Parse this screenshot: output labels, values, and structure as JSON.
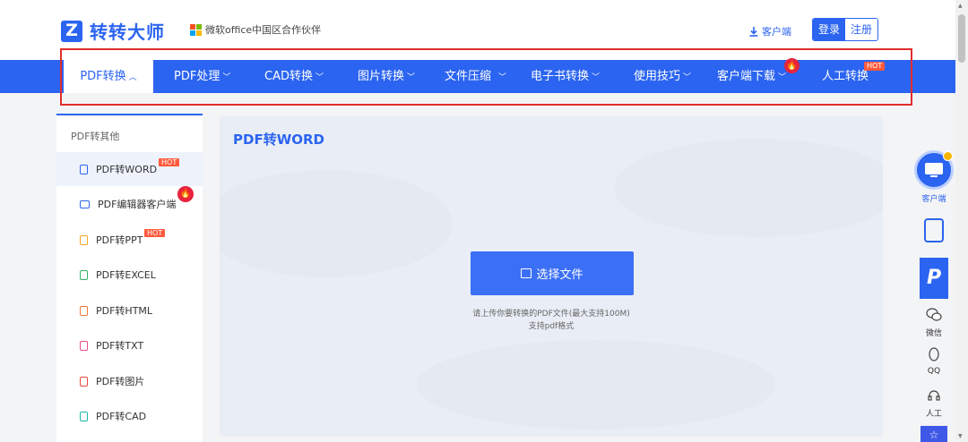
{
  "header": {
    "logo_text": "转转大师",
    "partner_text": "微软office中国区合作伙伴",
    "client_link": "客户端",
    "login": "登录",
    "register": "注册"
  },
  "nav": {
    "items": [
      {
        "label": "PDF转换",
        "chevron": "up",
        "active": true
      },
      {
        "label": "PDF处理",
        "chevron": "down"
      },
      {
        "label": "CAD转换",
        "chevron": "down"
      },
      {
        "label": "图片转换",
        "chevron": "down"
      },
      {
        "label": "文件压缩",
        "chevron": "down"
      },
      {
        "label": "电子书转换",
        "chevron": "down"
      },
      {
        "label": "使用技巧",
        "chevron": "down"
      },
      {
        "label": "客户端下载",
        "chevron": "down",
        "badge": "fire-icon"
      },
      {
        "label": "人工转换",
        "badge_text": "HOT"
      }
    ]
  },
  "sidebar": {
    "title": "PDF转其他",
    "items": [
      {
        "label": "PDF转WORD",
        "icon": "doc-icon",
        "color": "#2b64f0",
        "tag": "HOT",
        "active": true
      },
      {
        "label": "PDF编辑器客户端",
        "icon": "monitor-icon",
        "color": "#2b64f0",
        "badge": "fire-icon"
      },
      {
        "label": "PDF转PPT",
        "icon": "ppt-icon",
        "color": "#f5a623",
        "tag": "HOT"
      },
      {
        "label": "PDF转EXCEL",
        "icon": "excel-icon",
        "color": "#2fb36a"
      },
      {
        "label": "PDF转HTML",
        "icon": "html-icon",
        "color": "#f07b3f"
      },
      {
        "label": "PDF转TXT",
        "icon": "txt-icon",
        "color": "#e84d8a"
      },
      {
        "label": "PDF转图片",
        "icon": "image-icon",
        "color": "#e8473f"
      },
      {
        "label": "PDF转CAD",
        "icon": "cad-icon",
        "color": "#1fb5a8"
      }
    ]
  },
  "main": {
    "title": "PDF转WORD",
    "upload_button": "选择文件",
    "hint_line1": "请上传你要转换的PDF文件(最大支持100M)",
    "hint_line2": "支持pdf格式"
  },
  "rail": {
    "client_label": "客户端",
    "wechat_label": "微信",
    "qq_label": "QQ",
    "human_label": "人工",
    "p_tile": "P"
  },
  "colors": {
    "brand": "#2b64f0",
    "highlight_box": "#e02d2d",
    "hot": "#ff5a3c",
    "fire": "#e8233c"
  }
}
